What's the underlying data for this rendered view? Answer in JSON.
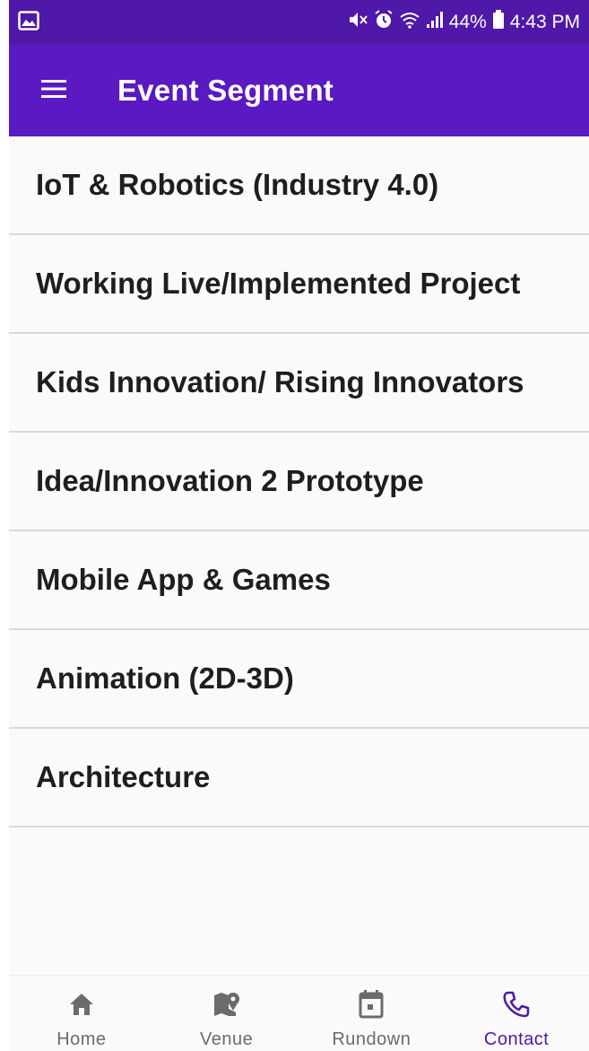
{
  "status_bar": {
    "battery": "44%",
    "time": "4:43 PM",
    "icons": [
      "image-icon",
      "mute-icon",
      "alarm-icon",
      "wifi-icon",
      "signal-icon",
      "battery-icon"
    ]
  },
  "app_bar": {
    "title": "Event Segment",
    "menu_icon": "hamburger-menu-icon"
  },
  "segments": [
    "IoT & Robotics (Industry 4.0)",
    "Working Live/Implemented Project",
    "Kids Innovation/ Rising Innovators",
    "Idea/Innovation 2 Prototype",
    "Mobile App & Games",
    "Animation (2D-3D)",
    "Architecture"
  ],
  "bottom_nav": {
    "items": [
      {
        "label": "Home",
        "icon": "home-icon",
        "active": false
      },
      {
        "label": "Venue",
        "icon": "map-pin-icon",
        "active": false
      },
      {
        "label": "Rundown",
        "icon": "calendar-icon",
        "active": false
      },
      {
        "label": "Contact",
        "icon": "phone-icon",
        "active": true
      }
    ]
  },
  "colors": {
    "status_bar": "#4f18a8",
    "app_bar": "#5a19c2",
    "active_nav": "#4f18a8",
    "inactive_nav": "#6b6b6b"
  }
}
